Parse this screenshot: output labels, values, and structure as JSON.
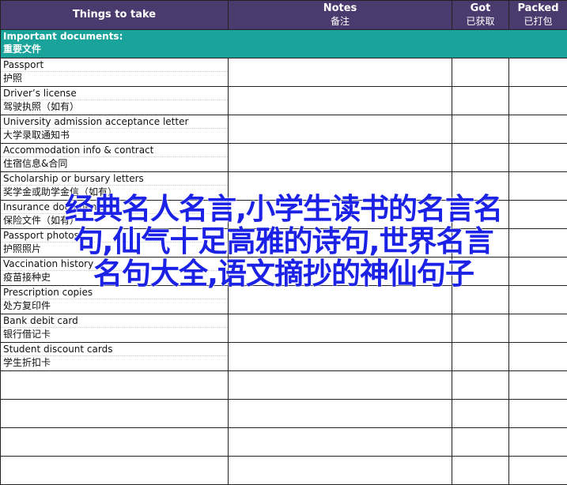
{
  "header": {
    "col1": "Things to take",
    "col2": "Notes",
    "col2_sub": "备注",
    "col3": "Got",
    "col3_sub": "已获取",
    "col4": "Packed",
    "col4_sub": "已打包"
  },
  "section": {
    "title_en": "Important documents:",
    "title_zh": "重要文件"
  },
  "items": [
    {
      "en": "Passport",
      "zh": "护照"
    },
    {
      "en": "Driver’s license",
      "zh": "驾驶执照（如有）"
    },
    {
      "en": "University admission acceptance letter",
      "zh": "大学录取通知书"
    },
    {
      "en": "Accommodation info & contract",
      "zh": "住宿信息&合同"
    },
    {
      "en": "Scholarship or bursary letters",
      "zh": "奖学金或助学金信（如有）"
    },
    {
      "en": "Insurance documents",
      "zh": "保险文件（如有）"
    },
    {
      "en": "Passport photos",
      "zh": "护照照片"
    },
    {
      "en": "Vaccination history",
      "zh": "疫苗接种史"
    },
    {
      "en": "Prescription copies",
      "zh": "处方复印件"
    },
    {
      "en": "Bank debit card",
      "zh": "银行借记卡"
    },
    {
      "en": "Student discount cards",
      "zh": "学生折扣卡"
    }
  ],
  "overlay": {
    "line1": "经典名人名言,小学生读书的名言名",
    "line2": "句,仙气十足高雅的诗句,世界名言",
    "line3": "名句大全,语文摘抄的神仙句子"
  }
}
